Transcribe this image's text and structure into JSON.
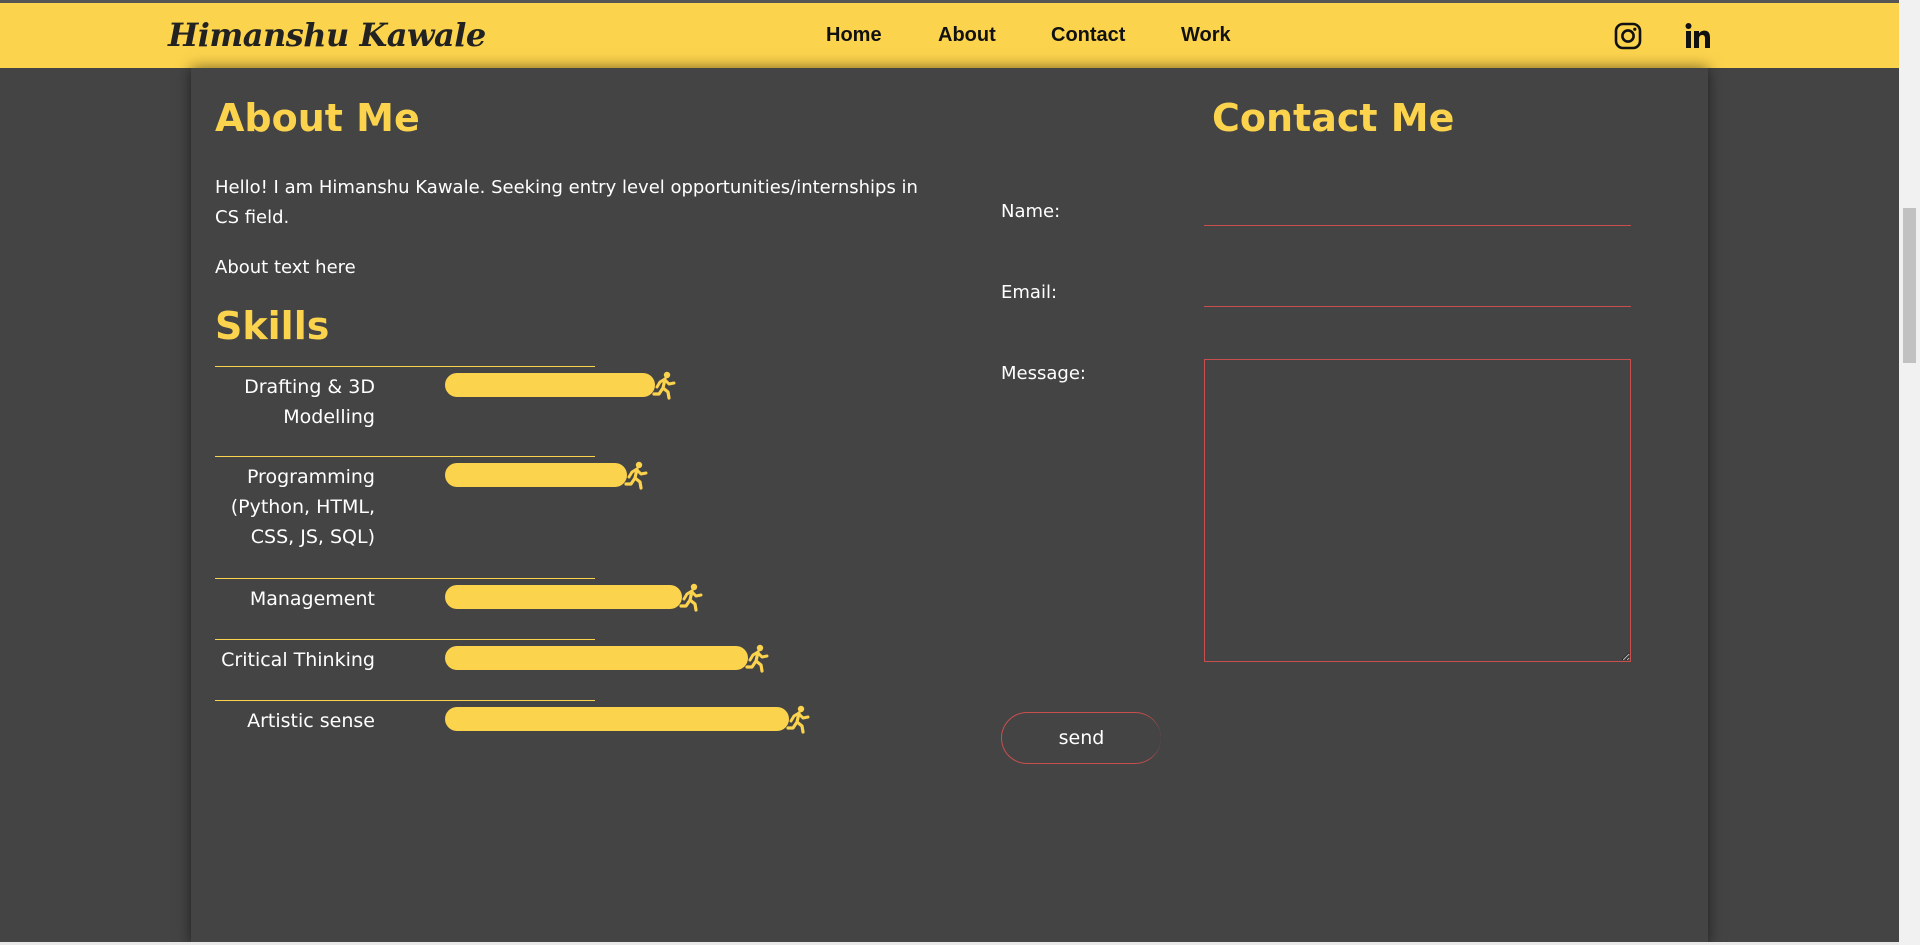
{
  "navbar": {
    "brand": "Himanshu Kawale",
    "links": [
      "Home",
      "About",
      "Contact",
      "Work"
    ],
    "social": [
      "instagram-icon",
      "linkedin-icon"
    ],
    "background": "#fcd34d"
  },
  "about": {
    "title": "About Me",
    "intro": "Hello! I am Himanshu Kawale. Seeking entry level opportunities/internships in CS field.",
    "text": "About text here"
  },
  "skills": {
    "title": "Skills",
    "items": [
      {
        "label": "Drafting & 3D Modelling",
        "level": 0.61
      },
      {
        "label": "Programming (Python, HTML, CSS, JS, SQL)",
        "level": 0.53
      },
      {
        "label": "Management",
        "level": 0.69
      },
      {
        "label": "Critical Thinking",
        "level": 0.88
      },
      {
        "label": "Artistic sense",
        "level": 1.0
      }
    ],
    "icon": "running-person-icon"
  },
  "contact": {
    "title": "Contact Me",
    "name_label": "Name:",
    "email_label": "Email:",
    "message_label": "Message:",
    "send_label": "send"
  },
  "colors": {
    "accent": "#fcd34d",
    "background": "#444444",
    "field_border": "#c94f4f"
  }
}
